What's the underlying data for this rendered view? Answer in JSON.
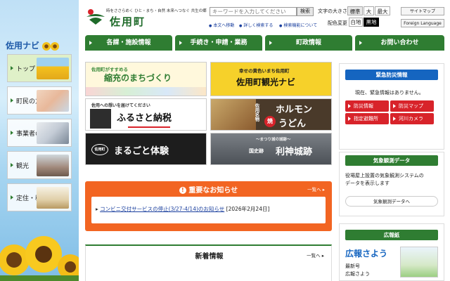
{
  "header": {
    "tagline": "時をささらめく ひと・まち・自然 未来へつなぐ 共生の郷",
    "logo_name": "佐用町",
    "search_placeholder": "キーワードを入力してください",
    "search_button": "検索",
    "font_size_label": "文字の大きさ",
    "font_sizes": [
      "標準",
      "大",
      "最大"
    ],
    "color_change_label": "配色変更",
    "color_white": "白地",
    "color_black": "黒地",
    "sitemap": "サイトマップ",
    "foreign_language": "Foreign Language",
    "access_links": [
      "本文へ移動",
      "詳しく検索する",
      "検索機能について"
    ]
  },
  "main_nav": [
    "各課・施設情報",
    "手続き・申請・業務",
    "町政情報",
    "お問い合わせ"
  ],
  "sidebar": {
    "title": "佐用ナビ",
    "items": [
      "トップ",
      "町民の方へ",
      "事業者の方へ",
      "観光",
      "定住・移住"
    ]
  },
  "banners": {
    "b1_sub": "佐用町がすすめる",
    "b1_main": "縮充のまちづくり",
    "b2_sub": "幸せの黄色いまち佐用町",
    "b2_main": "佐用町観光ナビ",
    "b3_sub": "佐用への想いを届けてください",
    "b3_main": "ふるさと納税",
    "b4_side": "佐用名物",
    "b4_main1": "ホルモン",
    "b4_burn": "焼",
    "b4_main2": "うどん",
    "b5_badge": "佐用町",
    "b5_main": "まるごと体験",
    "b6_sub": "〜まつり城の城跡〜",
    "b6_main_small": "国史跡",
    "b6_main": "利神城跡"
  },
  "notice": {
    "title": "重要なお知らせ",
    "more": "一覧へ",
    "item_link": "コンビニ交付サービスの停止(3/27-4/14)のお知らせ",
    "item_date": "[2026年2月24日]"
  },
  "news": {
    "title": "新着情報",
    "more": "一覧へ"
  },
  "disaster": {
    "title": "緊急防災情報",
    "status": "現在、緊急情報はありません。",
    "buttons": [
      "防災情報",
      "防災マップ",
      "指定避難所",
      "河川カメラ"
    ]
  },
  "weather": {
    "title": "気象観測データ",
    "desc_line1": "役場屋上設置の気象観測システムの",
    "desc_line2": "データを表示します",
    "button": "気象観測データへ"
  },
  "koho": {
    "title": "広報紙",
    "logo": "広報さよう",
    "latest_label": "最新号",
    "latest_name": "広報さよう"
  },
  "colors": {
    "green": "#2f7d32",
    "orange": "#f26522",
    "red": "#d8232a",
    "blue": "#1565c0"
  }
}
